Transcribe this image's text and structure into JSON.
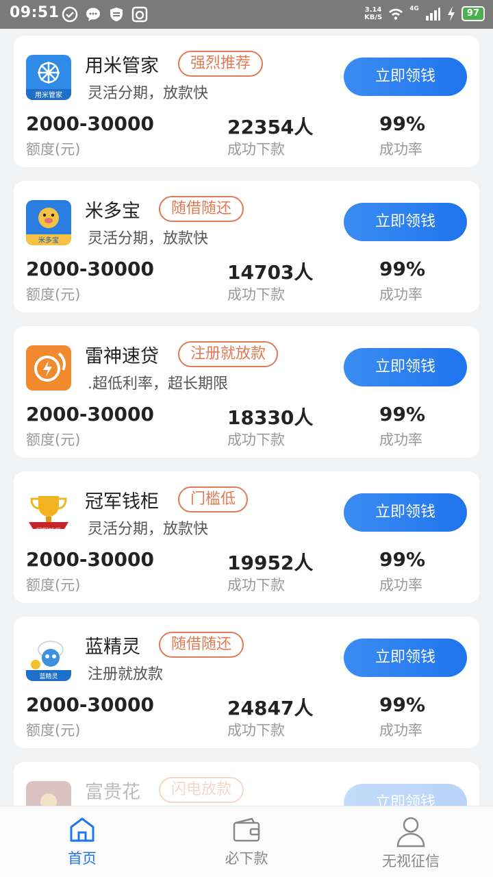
{
  "status_bar": {
    "time": "09:51",
    "net_speed_value": "3.14",
    "net_speed_unit": "KB/S",
    "network": "4G",
    "battery": "97",
    "icons": [
      "check-circle-icon",
      "chat-icon",
      "shield-icon",
      "clean-icon",
      "wifi-icon",
      "signal-icon",
      "charging-icon"
    ]
  },
  "products": [
    {
      "name": "用米管家",
      "tag": "强烈推荐",
      "desc": "灵活分期，放款快",
      "amount": "2000-30000",
      "amount_label": "额度(元)",
      "count": "22354人",
      "count_label": "成功下款",
      "rate": "99%",
      "rate_label": "成功率",
      "button": "立即领钱",
      "logo": "butler-logo",
      "logo_text": "用米管家"
    },
    {
      "name": "米多宝",
      "tag": "随借随还",
      "desc": "灵活分期，放款快",
      "amount": "2000-30000",
      "amount_label": "额度(元)",
      "count": "14703人",
      "count_label": "成功下款",
      "rate": "99%",
      "rate_label": "成功率",
      "button": "立即领钱",
      "logo": "piggy-logo",
      "logo_text": "米多宝"
    },
    {
      "name": "雷神速贷",
      "tag": "注册就放款",
      "desc": ".超低利率，超长期限",
      "amount": "2000-30000",
      "amount_label": "额度(元)",
      "count": "18330人",
      "count_label": "成功下款",
      "rate": "99%",
      "rate_label": "成功率",
      "button": "立即领钱",
      "logo": "lightning-logo",
      "logo_text": ""
    },
    {
      "name": "冠军钱柜",
      "tag": "门槛低",
      "desc": "灵活分期，放款快",
      "amount": "2000-30000",
      "amount_label": "额度(元)",
      "count": "19952人",
      "count_label": "成功下款",
      "rate": "99%",
      "rate_label": "成功率",
      "button": "立即领钱",
      "logo": "trophy-logo",
      "logo_text": "冠军钱柜"
    },
    {
      "name": "蓝精灵",
      "tag": "随借随还",
      "desc": "注册就放款",
      "amount": "2000-30000",
      "amount_label": "额度(元)",
      "count": "24847人",
      "count_label": "成功下款",
      "rate": "99%",
      "rate_label": "成功率",
      "button": "立即领钱",
      "logo": "smurf-logo",
      "logo_text": "蓝精灵"
    },
    {
      "name": "富贵花",
      "tag": "闪电放款",
      "desc": "",
      "amount": "",
      "amount_label": "",
      "count": "",
      "count_label": "",
      "rate": "",
      "rate_label": "",
      "button": "立即领钱",
      "logo": "flower-logo",
      "logo_text": ""
    }
  ],
  "tabbar": {
    "tabs": [
      {
        "label": "首页",
        "icon": "home-icon",
        "active": true
      },
      {
        "label": "必下款",
        "icon": "wallet-icon",
        "active": false
      },
      {
        "label": "无视征信",
        "icon": "user-icon",
        "active": false
      }
    ]
  },
  "colors": {
    "accent": "#1f74ee",
    "tag": "#e07a55",
    "tab_active": "#1f74ee",
    "tab_inactive": "#888888"
  }
}
